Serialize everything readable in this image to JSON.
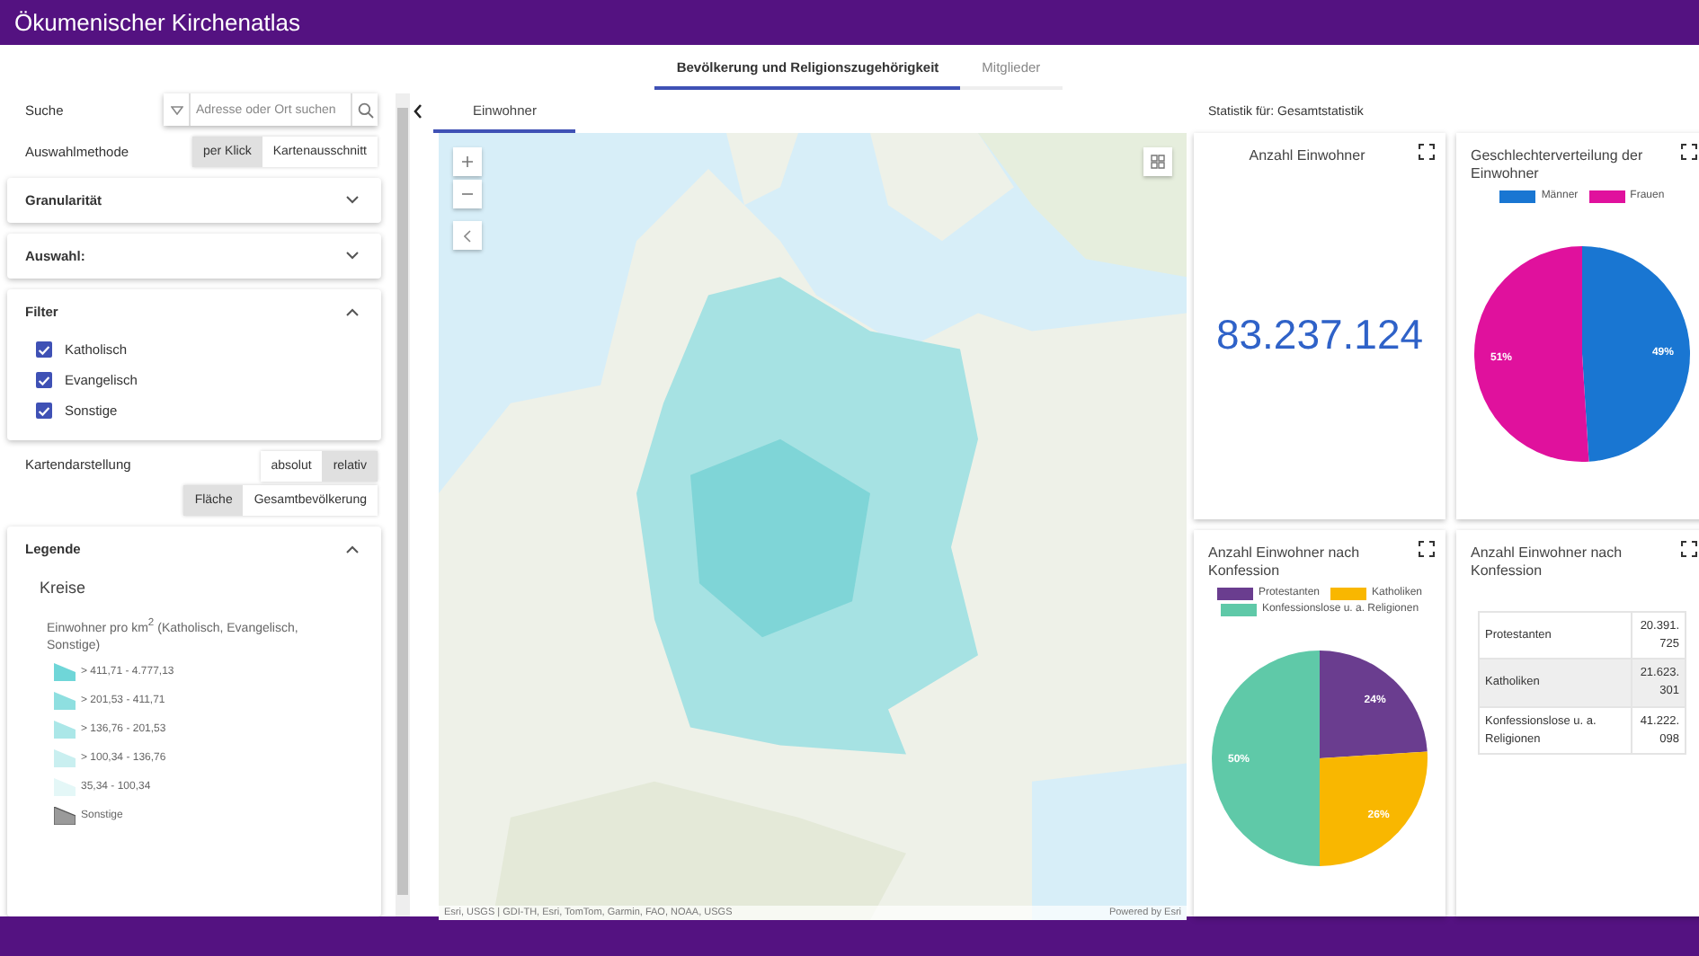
{
  "app": {
    "title": "Ökumenischer Kirchenatlas"
  },
  "main_tabs": [
    {
      "label": "Bevölkerung und Religionszugehörigkeit",
      "selected": true
    },
    {
      "label": "Mitglieder",
      "selected": false
    }
  ],
  "sidebar": {
    "search": {
      "label": "Suche",
      "placeholder": "Adresse oder Ort suchen"
    },
    "selection_method": {
      "label": "Auswahlmethode",
      "options": [
        {
          "label": "per Klick",
          "selected": true
        },
        {
          "label": "Kartenausschnitt",
          "selected": false
        }
      ]
    },
    "sections": [
      {
        "title": "Granularität",
        "expanded": false
      },
      {
        "title": "Auswahl:",
        "expanded": false
      }
    ],
    "filter": {
      "title": "Filter",
      "expanded": true,
      "items": [
        {
          "label": "Katholisch",
          "checked": true
        },
        {
          "label": "Evangelisch",
          "checked": true
        },
        {
          "label": "Sonstige",
          "checked": true
        }
      ]
    },
    "map_display": {
      "label": "Kartendarstellung",
      "mode": [
        {
          "label": "absolut",
          "selected": false
        },
        {
          "label": "relativ",
          "selected": true
        }
      ],
      "basis": [
        {
          "label": "Fläche",
          "selected": true
        },
        {
          "label": "Gesamtbevölkerung",
          "selected": false
        }
      ]
    },
    "legend": {
      "title": "Legende",
      "expanded": true,
      "layer": "Kreise",
      "field": "Einwohner pro km$^{2}$ (Katholisch, Evangelisch, Sonstige)",
      "classes": [
        {
          "label": "> 411,71 - 4.777,13",
          "color": "#6fd6d8"
        },
        {
          "label": "> 201,53 - 411,71",
          "color": "#8edfe0"
        },
        {
          "label": "> 136,76 - 201,53",
          "color": "#abe7e8"
        },
        {
          "label": "> 100,34 - 136,76",
          "color": "#c9eff0"
        },
        {
          "label": "35,34 - 100,34",
          "color": "#e4f7f7"
        },
        {
          "label": "Sonstige",
          "color": "#9a9a9a"
        }
      ]
    }
  },
  "map_panel": {
    "tabs": [
      {
        "label": "Einwohner",
        "selected": true
      }
    ],
    "attribution": "Esri, USGS | GDI-TH, Esri, TomTom, Garmin, FAO, NOAA, USGS",
    "powered_by": "Powered by Esri"
  },
  "statistics": {
    "heading": "Statistik für: Gesamtstatistik",
    "cards": [
      {
        "kind": "number",
        "title": "Anzahl Einwohner",
        "value": "83.237.124"
      },
      {
        "kind": "pie",
        "title": "Geschlechterverteilung der Einwohner",
        "chart_data": {
          "type": "pie",
          "categories": [
            "Männer",
            "Frauen"
          ],
          "values": [
            49,
            51
          ],
          "colors": [
            "#1976d2",
            "#e0119d"
          ],
          "value_labels": [
            "49%",
            "51%"
          ]
        }
      },
      {
        "kind": "pie",
        "title": "Anzahl Einwohner nach Konfession",
        "chart_data": {
          "type": "pie",
          "categories": [
            "Protestanten",
            "Katholiken",
            "Konfessionslose u. a. Religionen"
          ],
          "values": [
            24,
            26,
            50
          ],
          "colors": [
            "#6a3d8f",
            "#f9b700",
            "#5fc9a8"
          ],
          "value_labels": [
            "24%",
            "26%",
            "50%"
          ]
        }
      },
      {
        "kind": "table",
        "title": "Anzahl Einwohner nach Konfession",
        "rows": [
          {
            "label": "Protestanten",
            "value": "20.391.725"
          },
          {
            "label": "Katholiken",
            "value": "21.623.301"
          },
          {
            "label": "Konfessionslose u. a. Religionen",
            "value": "41.222.098"
          }
        ]
      }
    ]
  }
}
